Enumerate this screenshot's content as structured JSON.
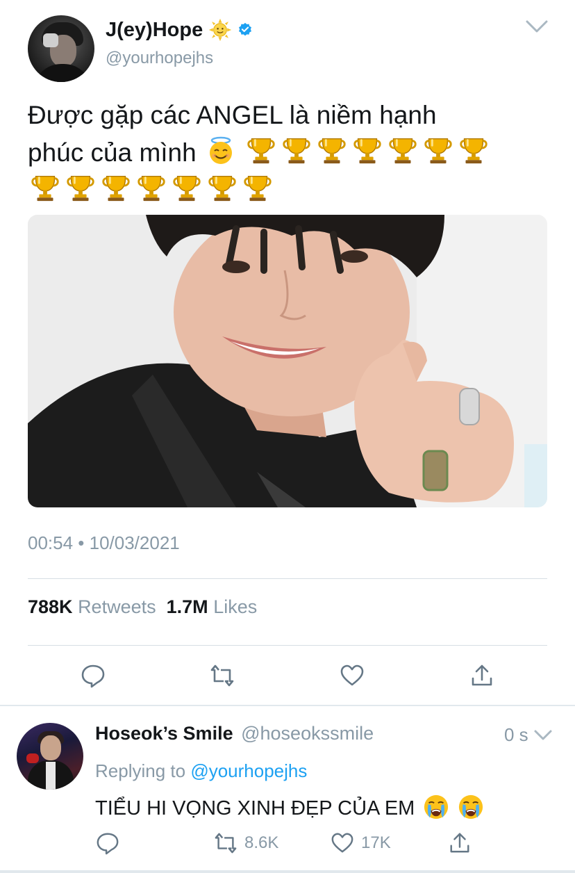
{
  "tweet": {
    "display_name": "J(ey)Hope",
    "handle": "@yourhopejhs",
    "name_emoji": "sun-with-face-icon",
    "verified": true,
    "text_line_1": "Được gặp các ANGEL là niềm hạnh",
    "text_line_2": "phúc của mình",
    "emojis": [
      "smiling-face-with-halo-icon",
      "trophy-icon"
    ],
    "trophy_count": 14,
    "timestamp": "00:54 • 10/03/2021",
    "retweets_count": "788K",
    "retweets_label": "Retweets",
    "likes_count": "1.7M",
    "likes_label": "Likes",
    "actions": [
      "reply-icon",
      "retweet-icon",
      "like-icon",
      "share-icon"
    ]
  },
  "reply": {
    "display_name": "Hoseok’s Smile",
    "handle": "@hoseokssmile",
    "time": "0 s",
    "replying_prefix": "Replying to",
    "replying_to": "@yourhopejhs",
    "text": "TIỂU HI VỌNG XINH ĐẸP CỦA EM",
    "text_emojis": [
      "loudly-crying-face-icon",
      "loudly-crying-face-icon"
    ],
    "retweets": "8.6K",
    "likes": "17K"
  },
  "colors": {
    "accent": "#1da1f2",
    "secondary_text": "#8899a6",
    "primary_text": "#14171a",
    "divider": "#e1e8ed"
  }
}
